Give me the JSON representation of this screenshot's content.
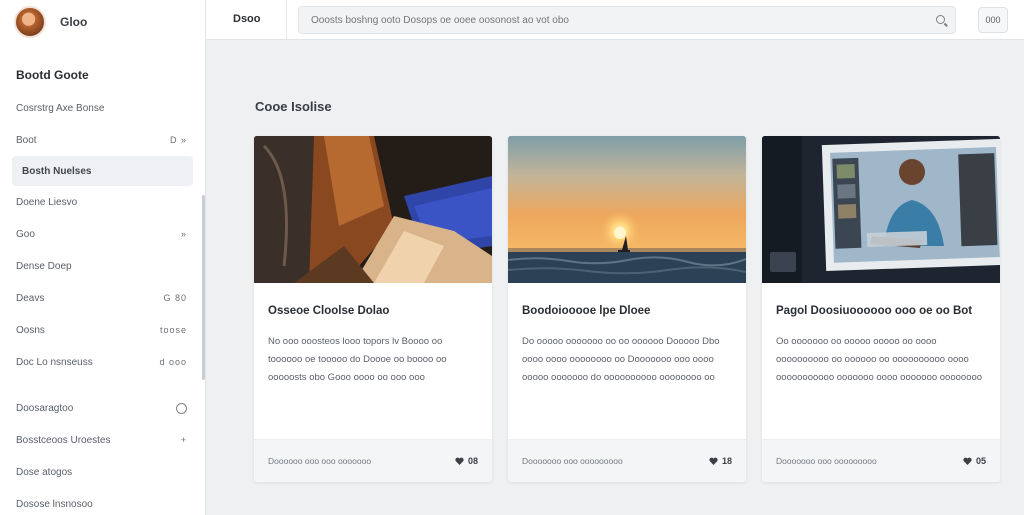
{
  "colors": {
    "sidebar_bg": "#ffffff",
    "page_bg": "#eef0f2",
    "active_item_bg": "#eef0f3",
    "card_footer_bg": "#f4f5f7"
  },
  "profile": {
    "name": "Gloo"
  },
  "sidebar": {
    "section_title": "Bootd Goote",
    "items": [
      {
        "label": "Cosrstrg Axe Bonse",
        "trail": ""
      },
      {
        "label": "Boot",
        "trail": "D  »"
      },
      {
        "label": "Bosth Nuelses",
        "trail": "",
        "active": true
      },
      {
        "label": "Doene Liesvo",
        "trail": ""
      },
      {
        "label": "Goo",
        "trail": "»"
      },
      {
        "label": "Dense Doep",
        "trail": ""
      },
      {
        "label": "Deavs",
        "trail": "G  80"
      },
      {
        "label": "Oosns",
        "trail": "toose"
      },
      {
        "label": "Doc Lo nsnseuss",
        "trail": "d  ooo"
      }
    ],
    "items2": [
      {
        "label": "Doosaragtoo",
        "trail": "info-icon"
      },
      {
        "label": "Bosstceoos Uroestes",
        "trail": "+"
      },
      {
        "label": "Dose atogos",
        "trail": ""
      },
      {
        "label": "Dosose lnsnosoo",
        "trail": ""
      }
    ]
  },
  "topbar": {
    "title": "Dsoo",
    "search_placeholder": "Ooosts boshng ooto Dosops oe ooee oosonost ao vot obo",
    "button_label": "000"
  },
  "main": {
    "section_title": "Cooe Isolise",
    "cards": [
      {
        "title": "Osseoe Cloolse Dolao",
        "text": "No ooo ooosteos looo topors lv Boooo oo toooooo oe tooooo do Doooe oo boooo oo ooooosts obo Gooo oooo oo ooo ooo",
        "meta": "Doooooo ooo ooo ooooooo",
        "stat": "08",
        "image": "abstract-folded-paper"
      },
      {
        "title": "Boodoiooooe lpe Dloee",
        "text": "Do ooooo ooooooo oo oo oooooo Dooooo Dbo oooo oooo oooooooo oo Dooooooo ooo oooo ooooo ooooooo do oooooooooo oooooooo oo",
        "meta": "Dooooooo ooo ooooooooo",
        "stat": "18",
        "image": "ocean-sunset-sailboat"
      },
      {
        "title": "Pagol Doosiuoooooo ooo oe oo Bot",
        "text": "Oo ooooooo oo ooooo ooooo oo oooo oooooooooo oo oooooo oo oooooooooo oooo ooooooooooo ooooooo oooo ooooooo oooooooo",
        "meta": "Dooooooo ooo ooooooooo",
        "stat": "05",
        "image": "person-on-monitor"
      }
    ]
  }
}
